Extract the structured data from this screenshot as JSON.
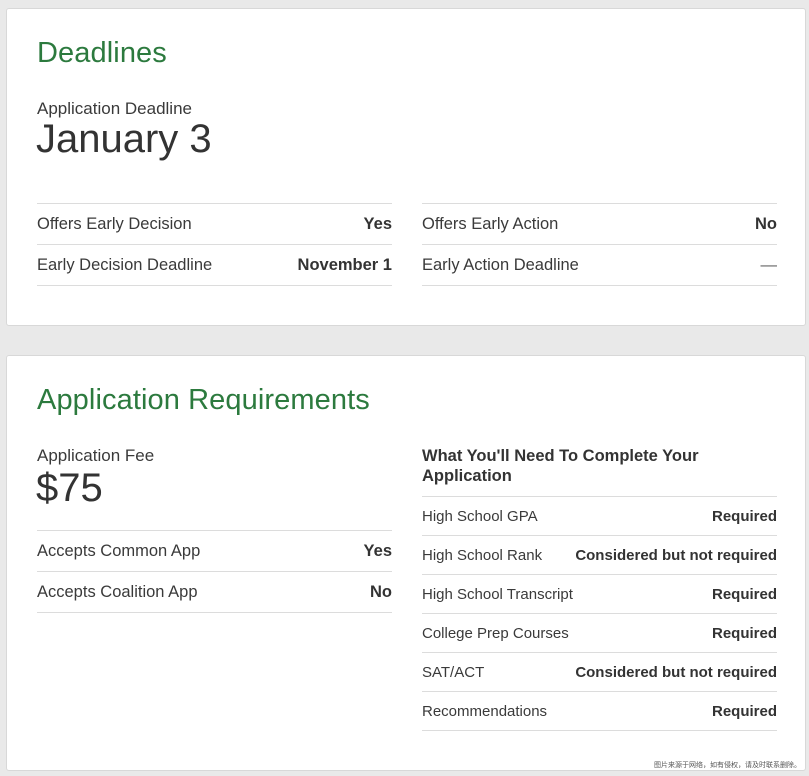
{
  "deadlines": {
    "title": "Deadlines",
    "application_deadline_label": "Application Deadline",
    "application_deadline_value": "January 3",
    "left_rows": [
      {
        "key": "Offers Early Decision",
        "value": "Yes"
      },
      {
        "key": "Early Decision Deadline",
        "value": "November 1"
      }
    ],
    "right_rows": [
      {
        "key": "Offers Early Action",
        "value": "No"
      },
      {
        "key": "Early Action Deadline",
        "value": "—"
      }
    ]
  },
  "requirements": {
    "title": "Application Requirements",
    "fee_label": "Application Fee",
    "fee_value": "$75",
    "left_rows": [
      {
        "key": "Accepts Common App",
        "value": "Yes"
      },
      {
        "key": "Accepts Coalition App",
        "value": "No"
      }
    ],
    "need_heading": "What You'll Need To Complete Your Application",
    "need_rows": [
      {
        "key": "High School GPA",
        "value": "Required"
      },
      {
        "key": "High School Rank",
        "value": "Considered but not required"
      },
      {
        "key": "High School Transcript",
        "value": "Required"
      },
      {
        "key": "College Prep Courses",
        "value": "Required"
      },
      {
        "key": "SAT/ACT",
        "value": "Considered but not required"
      },
      {
        "key": "Recommendations",
        "value": "Required"
      }
    ]
  },
  "watermark": "图片来源于网络，如有侵权，请及时联系删除。"
}
